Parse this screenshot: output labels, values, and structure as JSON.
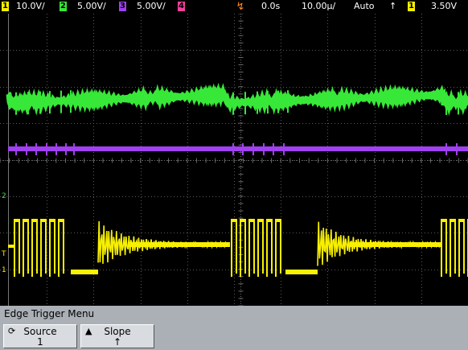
{
  "topbar": {
    "ch1": {
      "num": "1",
      "scale": "10.0V/",
      "color": "#f8f000"
    },
    "ch2": {
      "num": "2",
      "scale": "5.00V/",
      "color": "#38e838"
    },
    "ch3": {
      "num": "3",
      "scale": "5.00V/",
      "color": "#a040f0"
    },
    "ch4": {
      "num": "4",
      "color": "#f0409c"
    },
    "delay": "0.0s",
    "timebase": "10.00µ/",
    "trigger_mode": "Auto",
    "slope_symbol": "↑",
    "trigger_source": "1",
    "trigger_level": "3.50V"
  },
  "markers": {
    "ch2": "2",
    "ch1_a": "T",
    "ch1_b": "1"
  },
  "menu": {
    "title": "Edge Trigger Menu",
    "softkeys": [
      {
        "label": "Source",
        "value": "1",
        "icon": "rotate-knob-icon"
      },
      {
        "label": "Slope",
        "value": "↑",
        "icon": "triangle-up-icon"
      }
    ]
  },
  "colors": {
    "grid": "#5a5a5a",
    "ch1": "#f8f000",
    "ch2": "#38e838",
    "ch3": "#a040f0",
    "trigger": "#ff8a20",
    "menu": "#aab0b6"
  }
}
